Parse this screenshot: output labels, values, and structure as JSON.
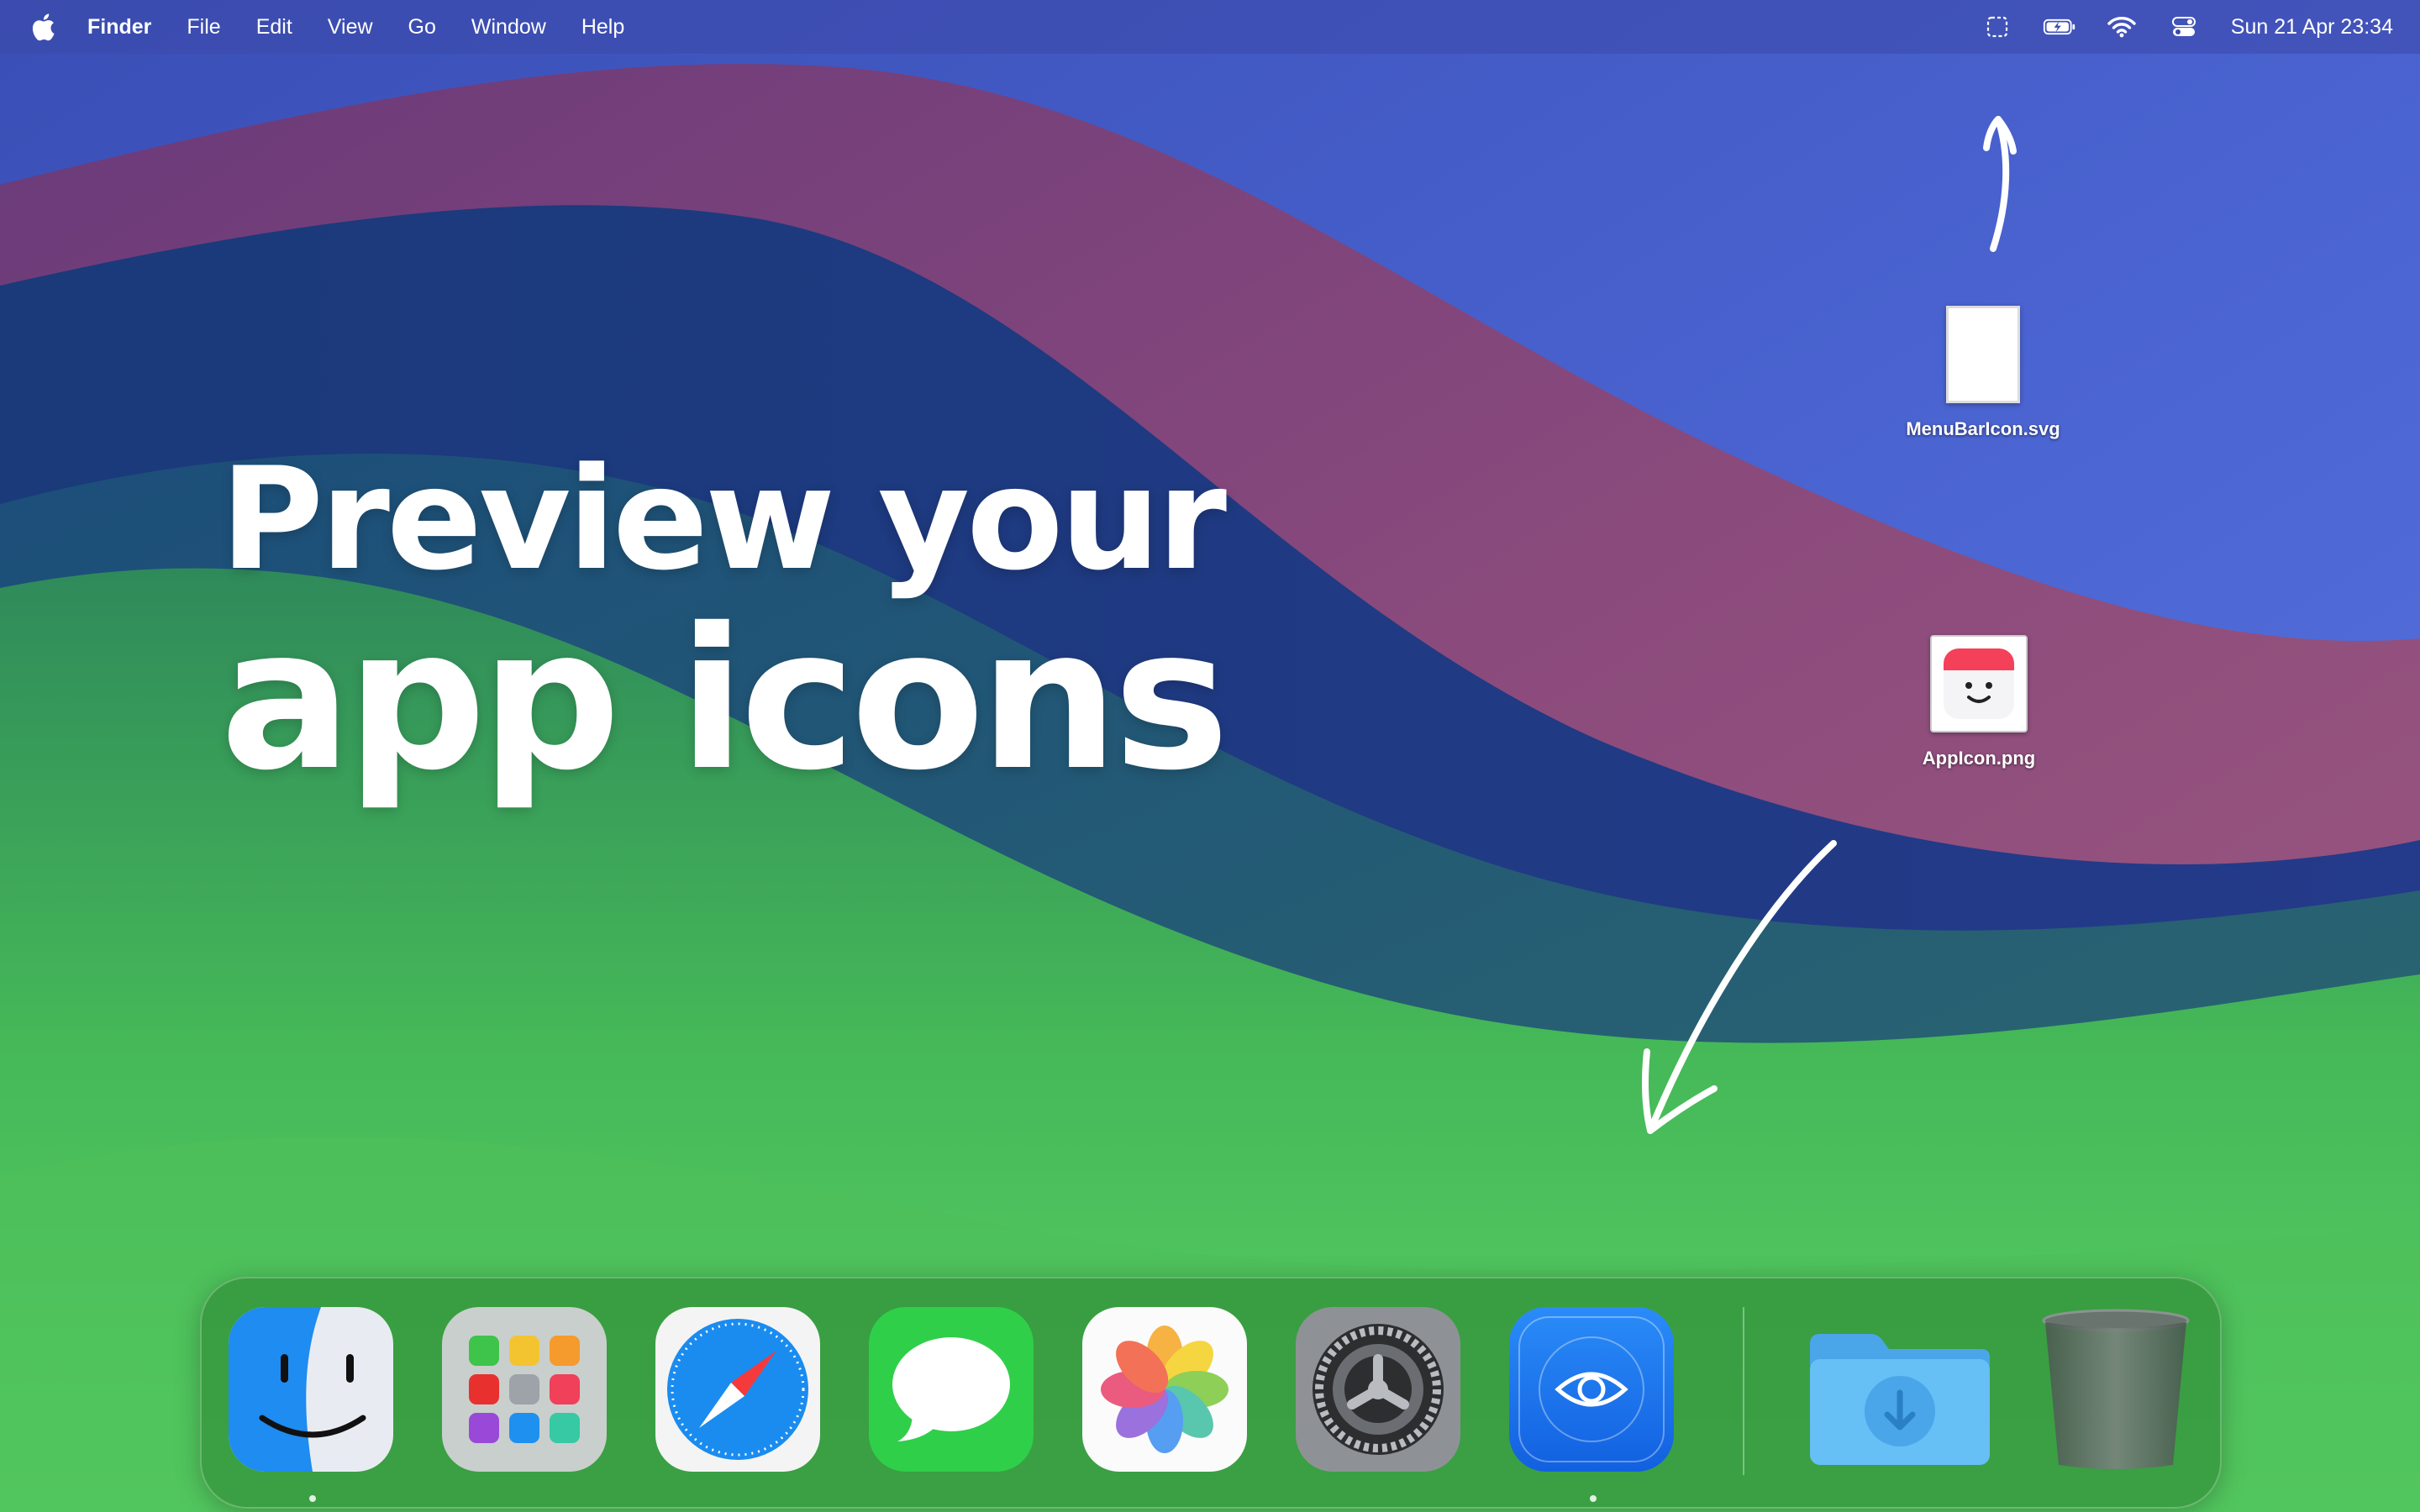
{
  "menubar": {
    "apple_icon": "apple-logo-icon",
    "app_name": "Finder",
    "menus": [
      "File",
      "Edit",
      "View",
      "Go",
      "Window",
      "Help"
    ],
    "status_icons": [
      "screen-capture-icon",
      "battery-charging-icon",
      "wifi-icon",
      "control-center-icon"
    ],
    "clock": "Sun 21 Apr  23:34"
  },
  "headline": {
    "line1": "Preview your",
    "line2": "app icons"
  },
  "desktop_files": [
    {
      "name": "MenuBarIcon.svg",
      "icon": "blank-document-icon"
    },
    {
      "name": "AppIcon.png",
      "icon": "smiley-app-icon"
    }
  ],
  "dock": {
    "apps": [
      {
        "name": "Finder",
        "icon": "finder-icon",
        "running": true
      },
      {
        "name": "Launchpad",
        "icon": "launchpad-icon",
        "running": false
      },
      {
        "name": "Safari",
        "icon": "safari-compass-icon",
        "running": false
      },
      {
        "name": "Messages",
        "icon": "messages-bubble-icon",
        "running": false
      },
      {
        "name": "Photos",
        "icon": "photos-flower-icon",
        "running": false
      },
      {
        "name": "System Settings",
        "icon": "settings-gear-icon",
        "running": false
      },
      {
        "name": "Preview app",
        "icon": "eye-icon",
        "running": true
      }
    ],
    "stack_items": [
      {
        "name": "Downloads",
        "icon": "downloads-folder-icon"
      },
      {
        "name": "Trash",
        "icon": "trash-can-icon"
      }
    ]
  },
  "colors": {
    "menubar": "#3c48aa",
    "wallpaper_top": "#3a52b8",
    "wallpaper_wave_pink": "#8a4a7a",
    "wallpaper_green": "#4ec85c",
    "dock_tint": "#28822d"
  }
}
